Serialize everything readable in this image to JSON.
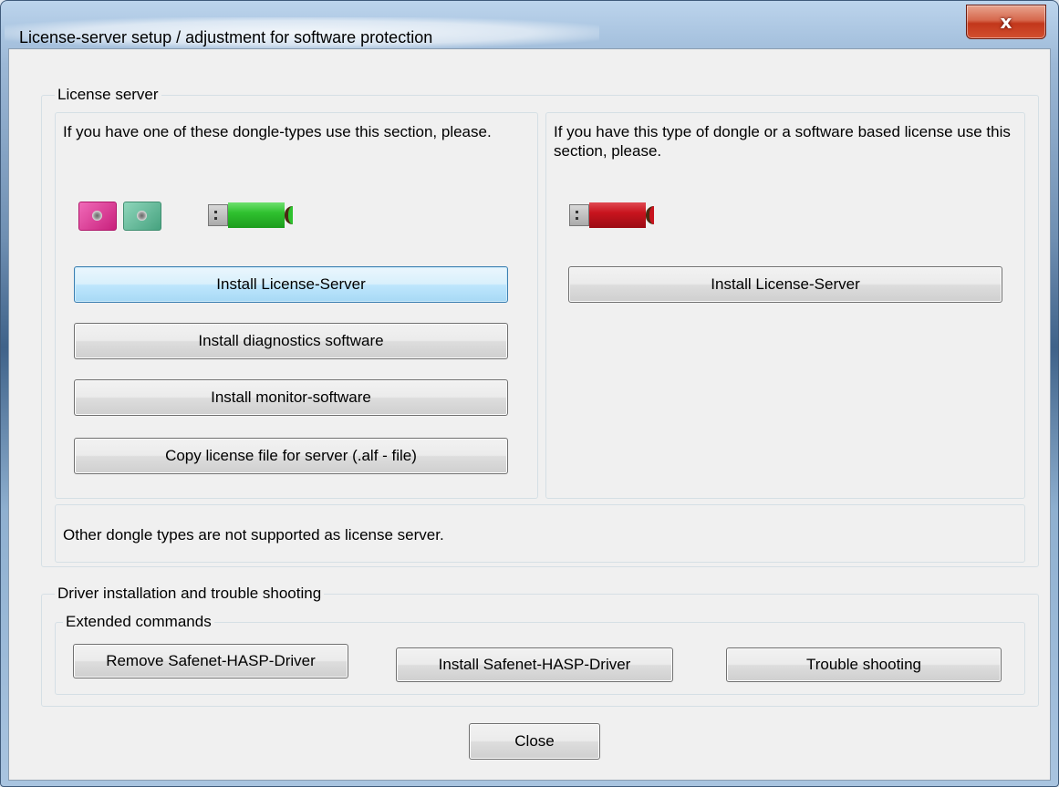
{
  "window": {
    "title": "License-server setup / adjustment for software protection",
    "close_glyph": "x"
  },
  "license_server": {
    "group_label": "License server",
    "left": {
      "description": "If you have one of these dongle-types use this section, please.",
      "dongle_icons": [
        "pink-dongle-icon",
        "teal-dongle-icon",
        "green-usb-dongle-icon"
      ],
      "buttons": {
        "install_server": "Install License-Server",
        "install_diagnostics": "Install diagnostics software",
        "install_monitor": "Install monitor-software",
        "copy_license": "Copy license file for server (.alf - file)"
      }
    },
    "right": {
      "description": "If you have this type of dongle or a software based license use this section, please.",
      "dongle_icons": [
        "red-usb-dongle-icon"
      ],
      "buttons": {
        "install_server": "Install License-Server"
      }
    },
    "note": "Other dongle types are not supported as license server."
  },
  "driver": {
    "group_label": "Driver installation and trouble shooting",
    "extended_label": "Extended commands",
    "buttons": {
      "remove_driver": "Remove Safenet-HASP-Driver",
      "install_driver": "Install Safenet-HASP-Driver",
      "trouble_shooting": "Trouble shooting"
    }
  },
  "footer": {
    "close": "Close"
  },
  "colors": {
    "dongle_pink": "#e0409a",
    "dongle_teal": "#5fb99a",
    "usb_green": "#2fc12f",
    "usb_red": "#c8141e",
    "focus_blue": "#3c7fb1"
  }
}
